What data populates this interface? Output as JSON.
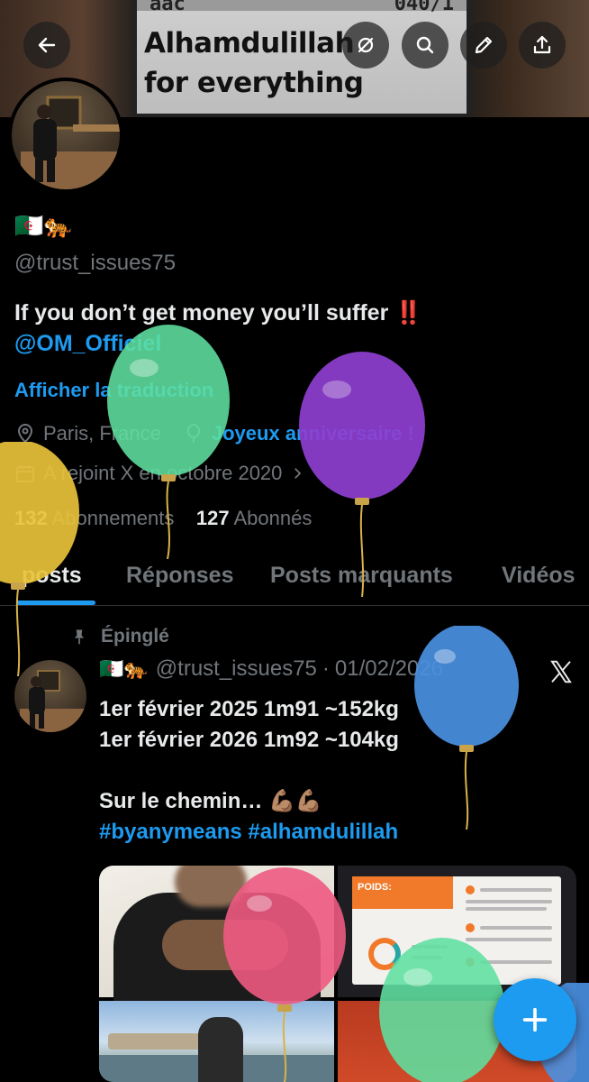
{
  "banner": {
    "screen_text_line1": "Alhamdulillah",
    "screen_text_line2": "for everything",
    "screen_fragment_left": "aac",
    "screen_fragment_right": "040/1"
  },
  "header_icons": [
    "back-arrow-icon",
    "eye-off-icon",
    "search-icon",
    "pencil-icon",
    "share-icon"
  ],
  "profile": {
    "name_emojis": "🇩🇿🐅",
    "handle": "@trust_issues75",
    "bio": "If you don’t get money you’ll suffer ‼️",
    "bio_mention": "@OM_Officiel",
    "translate_label": "Afficher la traduction",
    "location": "Paris, France",
    "birthday": "Joyeux anniversaire !",
    "joined": "A rejoint X en octobre 2020",
    "following_count": "132",
    "following_label": "Abonnements",
    "followers_count": "127",
    "followers_label": "Abonnés"
  },
  "tabs": [
    {
      "label": "posts",
      "active": true
    },
    {
      "label": "Réponses",
      "active": false
    },
    {
      "label": "Posts marquants",
      "active": false
    },
    {
      "label": "Vidéos",
      "active": false
    }
  ],
  "pinned_post": {
    "pinned_label": "Épinglé",
    "flags": "🇩🇿🐅",
    "handle": "@trust_issues75",
    "separator": "·",
    "date": "01/02/2026",
    "line1": "1er février 2025 1m91 ~152kg",
    "line2": "1er février 2026 1m92 ~104kg",
    "line3": "Sur le chemin… 💪🏽💪🏽",
    "hashtags": "#byanymeans #alhamdulillah"
  },
  "media_doc_title": "POIDS:",
  "colors": {
    "accent": "#1d9bf0",
    "muted": "#71767b",
    "text": "#e7e9ea",
    "background": "#000000",
    "balloon_green": "#5fe0a0",
    "balloon_purple": "#8e3fd0",
    "balloon_yellow": "#e8c23a",
    "balloon_blue": "#4a90e2",
    "balloon_pink": "#ee5a82"
  }
}
